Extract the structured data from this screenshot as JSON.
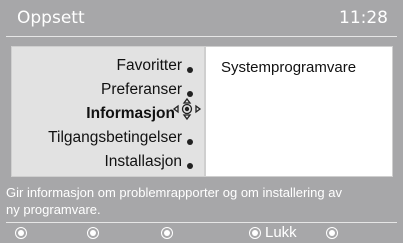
{
  "header": {
    "title": "Oppsett",
    "time": "11:28"
  },
  "menu": {
    "items": [
      {
        "label": "Favoritter"
      },
      {
        "label": "Preferanser"
      },
      {
        "label": "Informasjon",
        "selected": true
      },
      {
        "label": "Tilgangsbetingelser"
      },
      {
        "label": "Installasjon"
      }
    ]
  },
  "detail": {
    "item": "Systemprogramvare"
  },
  "help": {
    "line1": "Gir informasjon om problemrapporter og om installering av",
    "line2": "ny programvare."
  },
  "footer": {
    "close_label": "Lukk"
  },
  "colors": {
    "background": "#a7a7a9",
    "menu_panel": "#e2e2e2",
    "detail_panel": "#ffffff",
    "text_light": "#ffffff",
    "text_dark": "#111111"
  },
  "icons": {
    "nav": "navigation-cross-icon",
    "bullet": "bullet-icon",
    "button": "remote-button-icon"
  }
}
